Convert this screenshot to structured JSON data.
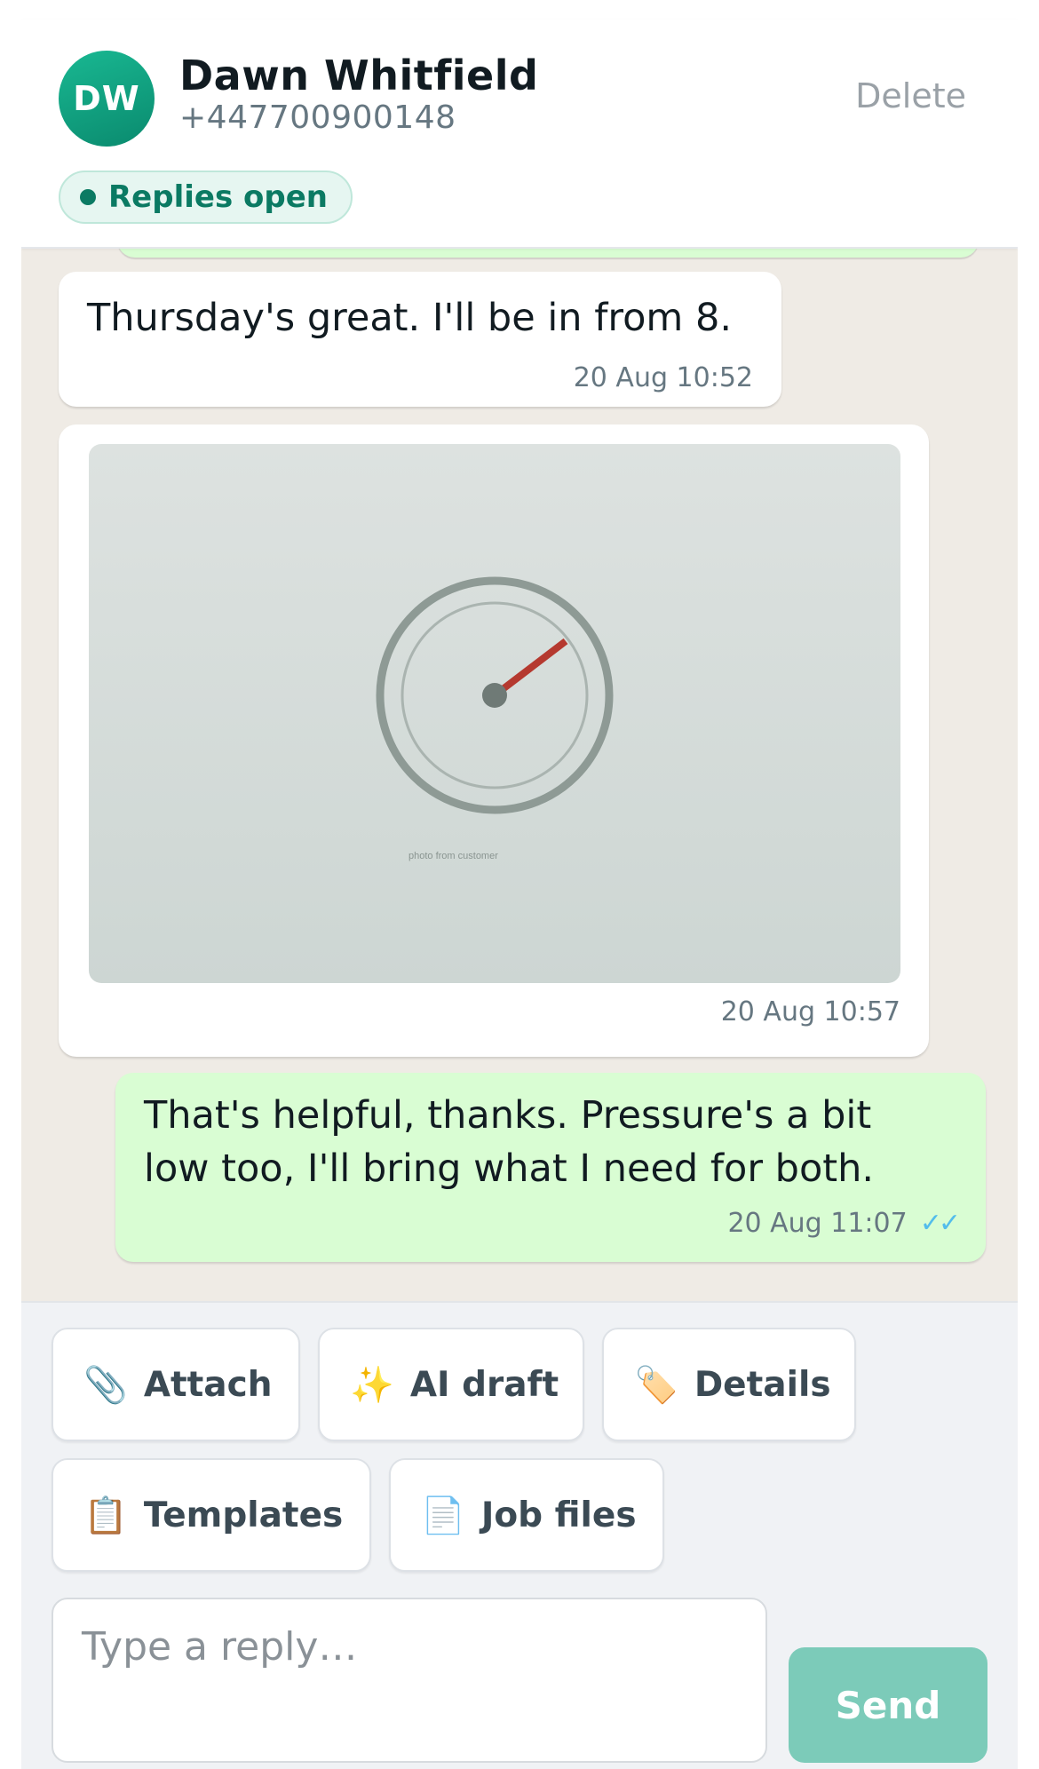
{
  "header": {
    "avatar_initials": "DW",
    "contact_name": "Dawn Whitfield",
    "contact_phone": "+447700900148",
    "delete_label": "Delete",
    "status_label": "Replies open"
  },
  "messages": [
    {
      "direction": "incoming",
      "type": "text",
      "text": "Thursday's great. I'll be in from 8.",
      "time": "20 Aug 10:52"
    },
    {
      "direction": "incoming",
      "type": "image",
      "image_caption": "photo from customer",
      "image_subject": "pressure-gauge",
      "time": "20 Aug 10:57"
    },
    {
      "direction": "outgoing",
      "type": "text",
      "text": "That's helpful, thanks. Pressure's a bit low too, I'll bring what I need for both.",
      "time": "20 Aug 11:07",
      "read_ticks": "✓✓"
    }
  ],
  "composer": {
    "actions": [
      {
        "label": "Attach",
        "icon": "paperclip-icon",
        "glyph": "📎"
      },
      {
        "label": "AI draft",
        "icon": "sparkles-icon",
        "glyph": "✨"
      },
      {
        "label": "Details",
        "icon": "tag-icon",
        "glyph": "🏷️"
      },
      {
        "label": "Templates",
        "icon": "clipboard-icon",
        "glyph": "📋"
      },
      {
        "label": "Job files",
        "icon": "document-icon",
        "glyph": "📄"
      }
    ],
    "reply_placeholder": "Type a reply…",
    "send_label": "Send"
  },
  "colors": {
    "accent": "#0a8a6e",
    "outgoing_bubble": "#d9fdd3",
    "chat_background": "#efebe5",
    "send_button": "#7ccbb9",
    "read_ticks": "#53bdeb"
  }
}
